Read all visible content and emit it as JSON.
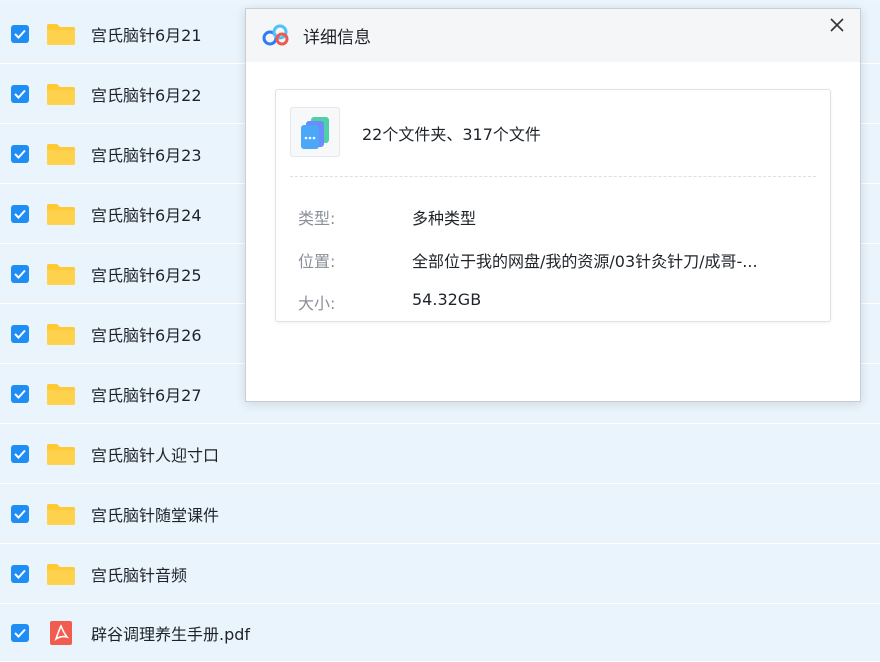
{
  "files": [
    {
      "name": "宫氏脑针6月21",
      "type": "folder",
      "checked": true
    },
    {
      "name": "宫氏脑针6月22",
      "type": "folder",
      "checked": true
    },
    {
      "name": "宫氏脑针6月23",
      "type": "folder",
      "checked": true
    },
    {
      "name": "宫氏脑针6月24",
      "type": "folder",
      "checked": true
    },
    {
      "name": "宫氏脑针6月25",
      "type": "folder",
      "checked": true
    },
    {
      "name": "宫氏脑针6月26",
      "type": "folder",
      "checked": true
    },
    {
      "name": "宫氏脑针6月27",
      "type": "folder",
      "checked": true
    },
    {
      "name": "宫氏脑针人迎寸口",
      "type": "folder",
      "checked": true
    },
    {
      "name": "宫氏脑针随堂课件",
      "type": "folder",
      "checked": true
    },
    {
      "name": "宫氏脑针音频",
      "type": "folder",
      "checked": true
    },
    {
      "name": "辟谷调理养生手册.pdf",
      "type": "pdf",
      "checked": true
    }
  ],
  "dialog": {
    "title": "详细信息",
    "summary": "22个文件夹、317个文件",
    "props": [
      {
        "label": "类型:",
        "value": "多种类型"
      },
      {
        "label": "位置:",
        "value": "全部位于我的网盘/我的资源/03针灸针刀/成哥-..."
      },
      {
        "label": "大小:",
        "value": "54.32GB"
      }
    ]
  },
  "icons": {
    "checkbox": "checkbox-checked-icon",
    "folder": "folder-icon",
    "pdf": "pdf-icon",
    "logo": "baidu-netdisk-logo-icon",
    "close": "close-icon",
    "multi": "multiple-files-icon"
  },
  "colors": {
    "accent": "#1e8ef5",
    "folder": "#ffc933",
    "pdf": "#f25b50",
    "row_bg": "#e9f4fc"
  }
}
